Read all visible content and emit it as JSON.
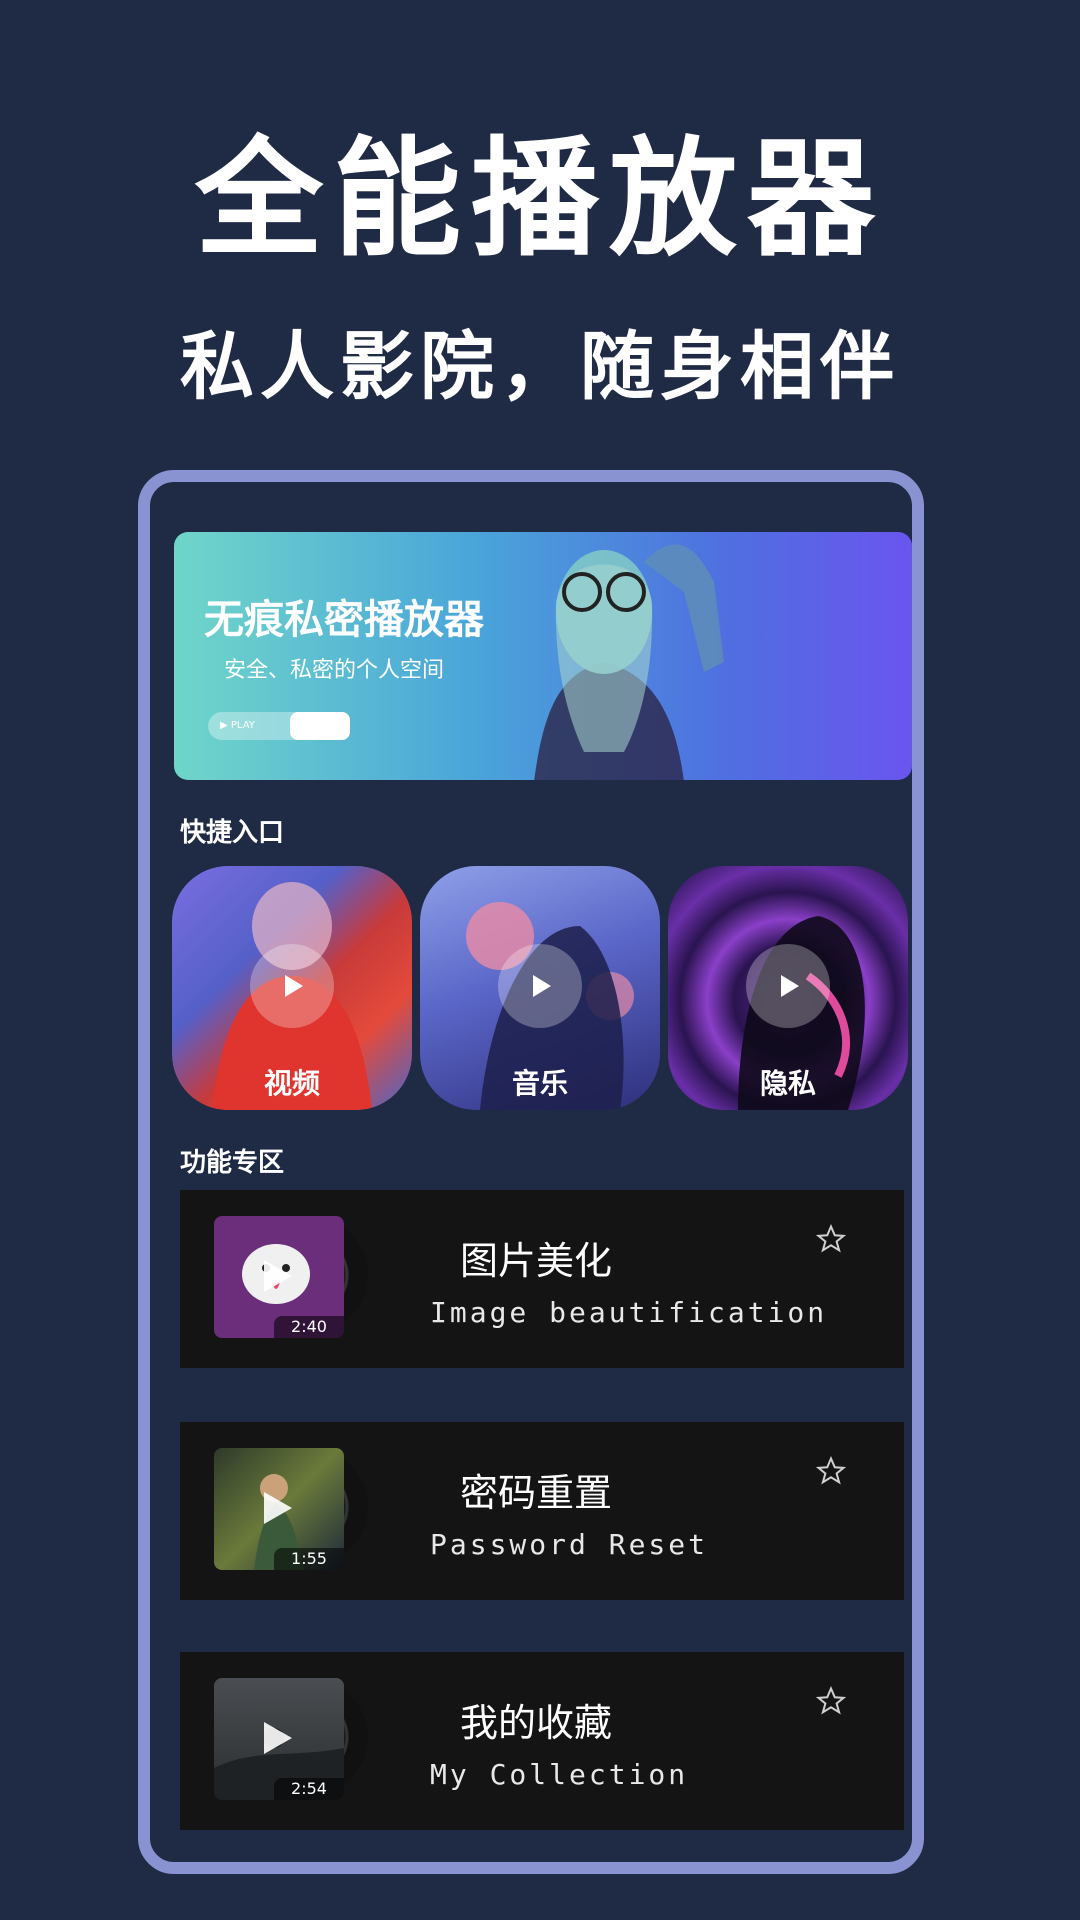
{
  "headline": "全能播放器",
  "subline": "私人影院，随身相伴",
  "banner": {
    "title": "无痕私密播放器",
    "subtitle": "安全、私密的个人空间",
    "play_label": "PLAY"
  },
  "quick_entry": {
    "title": "快捷入口",
    "items": [
      {
        "label": "视频",
        "icon": "play-icon"
      },
      {
        "label": "音乐",
        "icon": "play-icon"
      },
      {
        "label": "隐私",
        "icon": "play-icon"
      }
    ]
  },
  "features": {
    "title": "功能专区",
    "items": [
      {
        "title": "图片美化",
        "subtitle": "Image beautification",
        "duration": "2:40",
        "icon": "star-icon"
      },
      {
        "title": "密码重置",
        "subtitle": "Password Reset",
        "duration": "1:55",
        "icon": "star-icon"
      },
      {
        "title": "我的收藏",
        "subtitle": "My Collection",
        "duration": "2:54",
        "icon": "star-icon"
      }
    ]
  },
  "colors": {
    "background": "#1f2a44",
    "frame": "#8a93d2",
    "row_bg": "#141414"
  }
}
